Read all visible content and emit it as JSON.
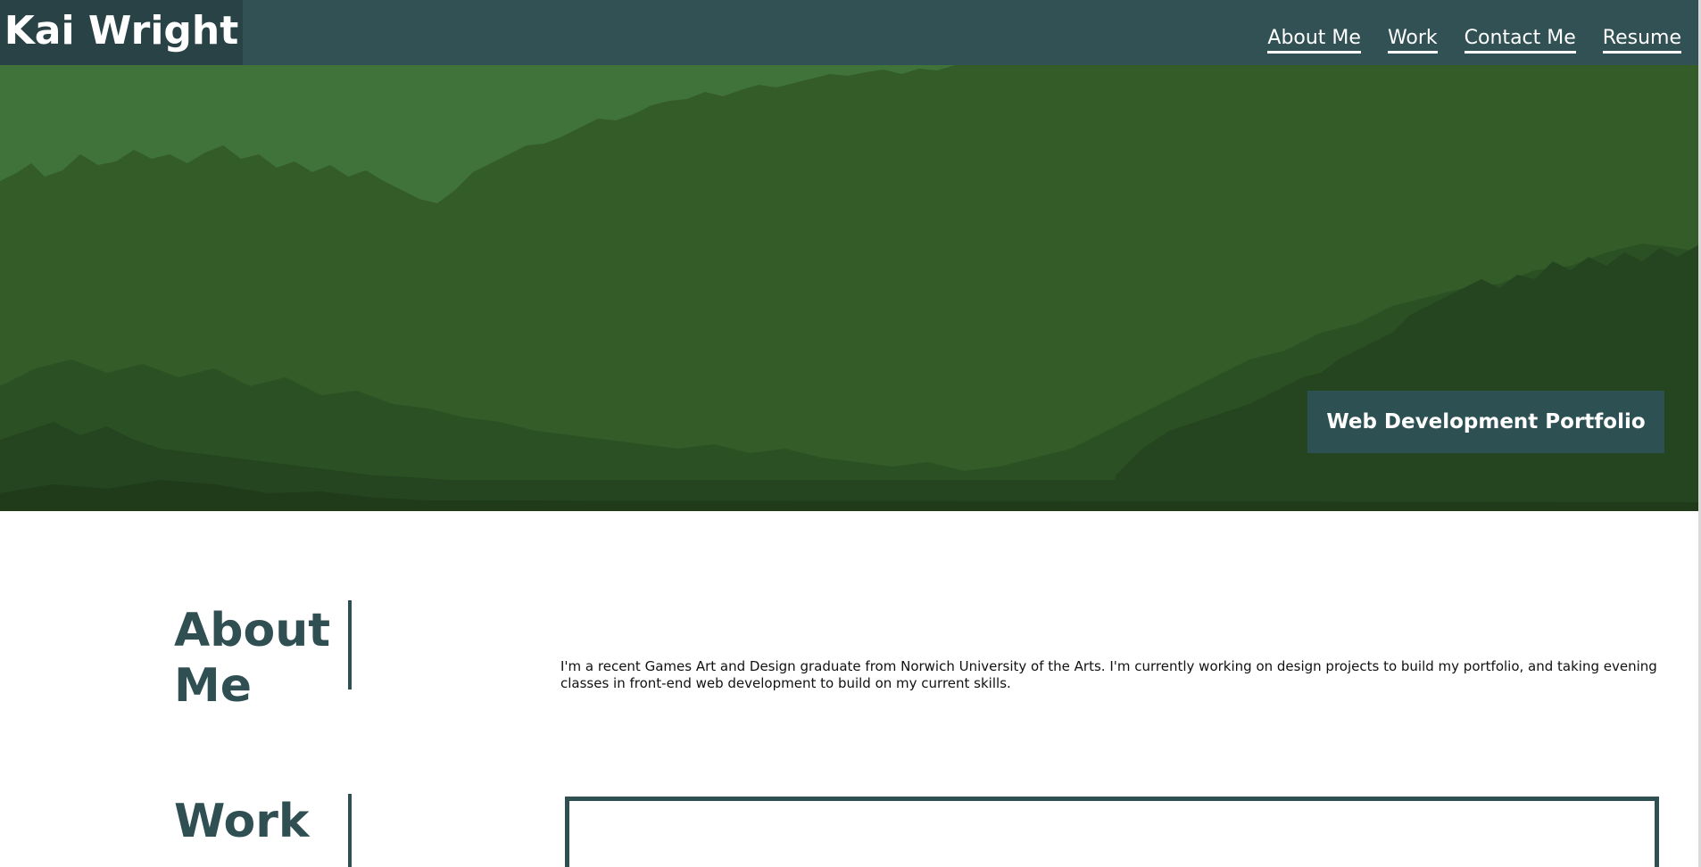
{
  "header": {
    "brand": "Kai Wright",
    "nav": [
      {
        "label": "About Me"
      },
      {
        "label": "Work"
      },
      {
        "label": "Contact Me"
      },
      {
        "label": "Resume"
      }
    ]
  },
  "hero": {
    "banner_label": "Web Development Portfolio"
  },
  "about": {
    "title_line1": "About",
    "title_line2": "Me",
    "body": "I'm a recent Games Art and Design graduate from Norwich University of the Arts. I'm currently working on design projects to build my portfolio, and taking evening classes in front-end web development to build on my current skills."
  },
  "work": {
    "title": "Work"
  },
  "colors": {
    "header_bg": "#315154",
    "brand_bg": "#284245",
    "accent": "#2f4f52",
    "hero_light": "#40733a",
    "hero_mid": "#335c29",
    "hero_dark": "#24451f"
  }
}
